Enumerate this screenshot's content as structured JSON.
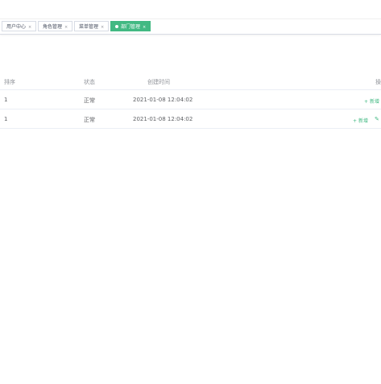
{
  "tags": [
    {
      "label": "用户中心",
      "close": "×"
    },
    {
      "label": "角色管理",
      "close": "×"
    },
    {
      "label": "菜单管理",
      "close": "×"
    },
    {
      "label": "部门管理",
      "close": "×",
      "active": true
    }
  ],
  "table": {
    "headers": {
      "sort": "排序",
      "status": "状态",
      "created": "创建时间",
      "operation": "操"
    },
    "rows": [
      {
        "sort": "1",
        "status": "正常",
        "created": "2021-01-08 12:04:02",
        "add_label": "新增"
      },
      {
        "sort": "1",
        "status": "正常",
        "created": "2021-01-08 12:04:02",
        "add_label": "新增",
        "edit_icon": "✎"
      }
    ]
  },
  "colors": {
    "accent": "#42b983",
    "border": "#d8dce5",
    "text": "#606266",
    "header_text": "#909399"
  },
  "icons": {
    "plus": "+",
    "edit": "edit-icon",
    "close": "close-icon",
    "dot": "active-dot"
  }
}
